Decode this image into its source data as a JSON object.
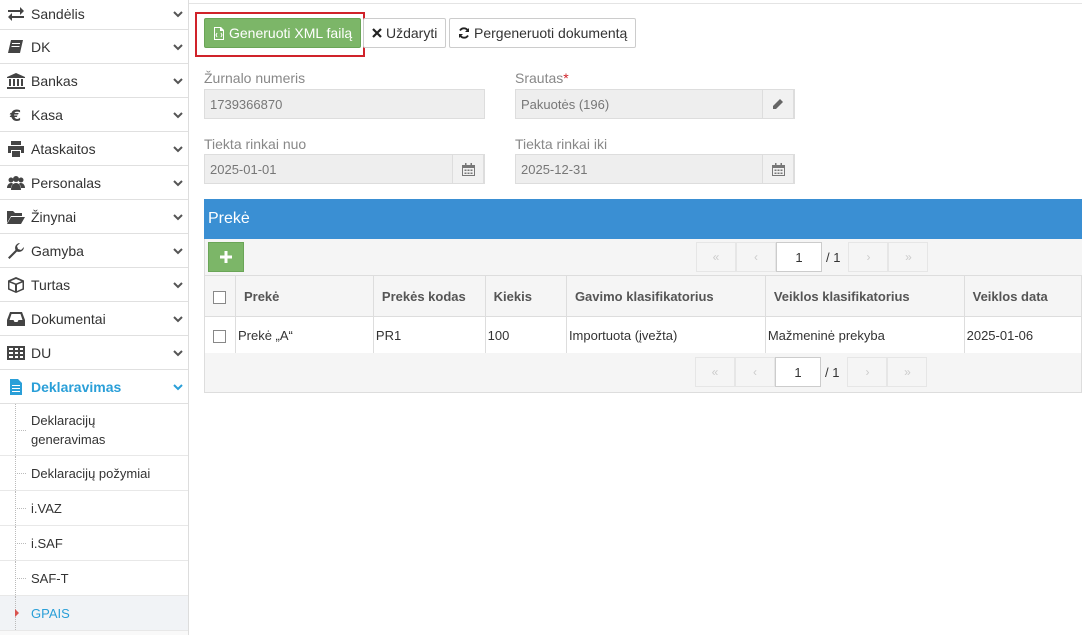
{
  "sidebar": {
    "items": [
      {
        "label": "Sandėlis"
      },
      {
        "label": "DK"
      },
      {
        "label": "Bankas"
      },
      {
        "label": "Kasa"
      },
      {
        "label": "Ataskaitos"
      },
      {
        "label": "Personalas"
      },
      {
        "label": "Žinynai"
      },
      {
        "label": "Gamyba"
      },
      {
        "label": "Turtas"
      },
      {
        "label": "Dokumentai"
      },
      {
        "label": "DU"
      },
      {
        "label": "Deklaravimas"
      }
    ],
    "sub_items": [
      {
        "label": "Deklaracijų generavimas"
      },
      {
        "label": "Deklaracijų požymiai"
      },
      {
        "label": "i.VAZ"
      },
      {
        "label": "i.SAF"
      },
      {
        "label": "SAF-T"
      },
      {
        "label": "GPAIS"
      }
    ]
  },
  "toolbar": {
    "generate_label": "Generuoti XML failą",
    "close_label": "Uždaryti",
    "regenerate_label": "Pergeneruoti dokumentą"
  },
  "form": {
    "journal_label": "Žurnalo numeris",
    "journal_value": "1739366870",
    "flow_label": "Srautas",
    "flow_required": "*",
    "flow_value": "Pakuotės (196)",
    "from_label": "Tiekta rinkai nuo",
    "from_value": "2025-01-01",
    "to_label": "Tiekta rinkai iki",
    "to_value": "2025-12-31"
  },
  "panel": {
    "title": "Prekė",
    "pager": {
      "page": "1",
      "total": "/ 1"
    }
  },
  "table": {
    "headers": [
      "Prekė",
      "Prekės kodas",
      "Kiekis",
      "Gavimo klasifikatorius",
      "Veiklos klasifikatorius",
      "Veiklos data"
    ],
    "rows": [
      [
        "Prekė „A“",
        "PR1",
        "100",
        "Importuota (įvežta)",
        "Mažmeninė prekyba",
        "2025-01-06"
      ]
    ]
  },
  "colors": {
    "accent": "#2a9fd8",
    "panel_header": "#3a8fd3",
    "green_button": "#7cb668",
    "highlight": "#d0232a"
  }
}
